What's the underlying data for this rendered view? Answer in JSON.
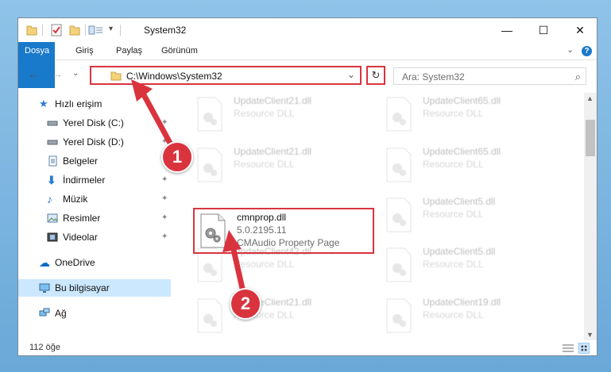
{
  "window": {
    "title": "System32",
    "minimize_glyph": "—",
    "maximize_glyph": "☐",
    "close_glyph": "✕"
  },
  "ribbon": {
    "tabs": [
      "Dosya",
      "Giriş",
      "Paylaş",
      "Görünüm"
    ],
    "expand_glyph": "⌄",
    "help_glyph": "?"
  },
  "address": {
    "path": "C:\\Windows\\System32",
    "refresh_glyph": "↻",
    "dropdown_glyph": "⌄"
  },
  "search": {
    "placeholder": "Ara: System32",
    "icon_glyph": "⌕"
  },
  "nav": {
    "back_glyph": "←",
    "forward_glyph": "→",
    "recent_glyph": "⌄",
    "up_glyph": "↑"
  },
  "sidebar": {
    "items": [
      {
        "label": "Hızlı erişim",
        "icon": "star-icon",
        "pinned": false
      },
      {
        "label": "Yerel Disk (C:)",
        "icon": "drive-icon",
        "pinned": true
      },
      {
        "label": "Yerel Disk (D:)",
        "icon": "drive-icon",
        "pinned": true
      },
      {
        "label": "Belgeler",
        "icon": "documents-icon",
        "pinned": true
      },
      {
        "label": "İndirmeler",
        "icon": "download-icon",
        "pinned": true
      },
      {
        "label": "Müzik",
        "icon": "music-icon",
        "pinned": true
      },
      {
        "label": "Resimler",
        "icon": "pictures-icon",
        "pinned": true
      },
      {
        "label": "Videolar",
        "icon": "video-icon",
        "pinned": true
      },
      {
        "label": "OneDrive",
        "icon": "cloud-icon",
        "pinned": false
      },
      {
        "label": "Bu bilgisayar",
        "icon": "computer-icon",
        "pinned": false
      },
      {
        "label": "Ağ",
        "icon": "network-icon",
        "pinned": false
      }
    ],
    "pin_glyph": "📌"
  },
  "files": {
    "col1": [
      {
        "name": "UpdateClient21.dll",
        "sub": "Resource DLL"
      },
      {
        "name": "UpdateClient21.dll",
        "sub": "Resource DLL"
      },
      {
        "name": "UpdateClient42.dll",
        "sub": "Resource DLL"
      },
      {
        "name": "UpdateClient21.dll",
        "sub": "Resource DLL"
      }
    ],
    "col2": [
      {
        "name": "UpdateClient65.dll",
        "sub": "Resource DLL"
      },
      {
        "name": "UpdateClient65.dll",
        "sub": "Resource DLL"
      },
      {
        "name": "UpdateClient5.dll",
        "sub": "Resource DLL"
      },
      {
        "name": "UpdateClient5.dll",
        "sub": "Resource DLL"
      },
      {
        "name": "UpdateClient19.dll",
        "sub": "Resource DLL"
      }
    ],
    "highlighted": {
      "name": "cmnprop.dll",
      "version": "5.0.2195.11",
      "description": "CMAudio Property Page"
    }
  },
  "status": {
    "count": "112 öğe"
  },
  "annotations": {
    "step1": "1",
    "step2": "2",
    "color": "#d9343e"
  }
}
